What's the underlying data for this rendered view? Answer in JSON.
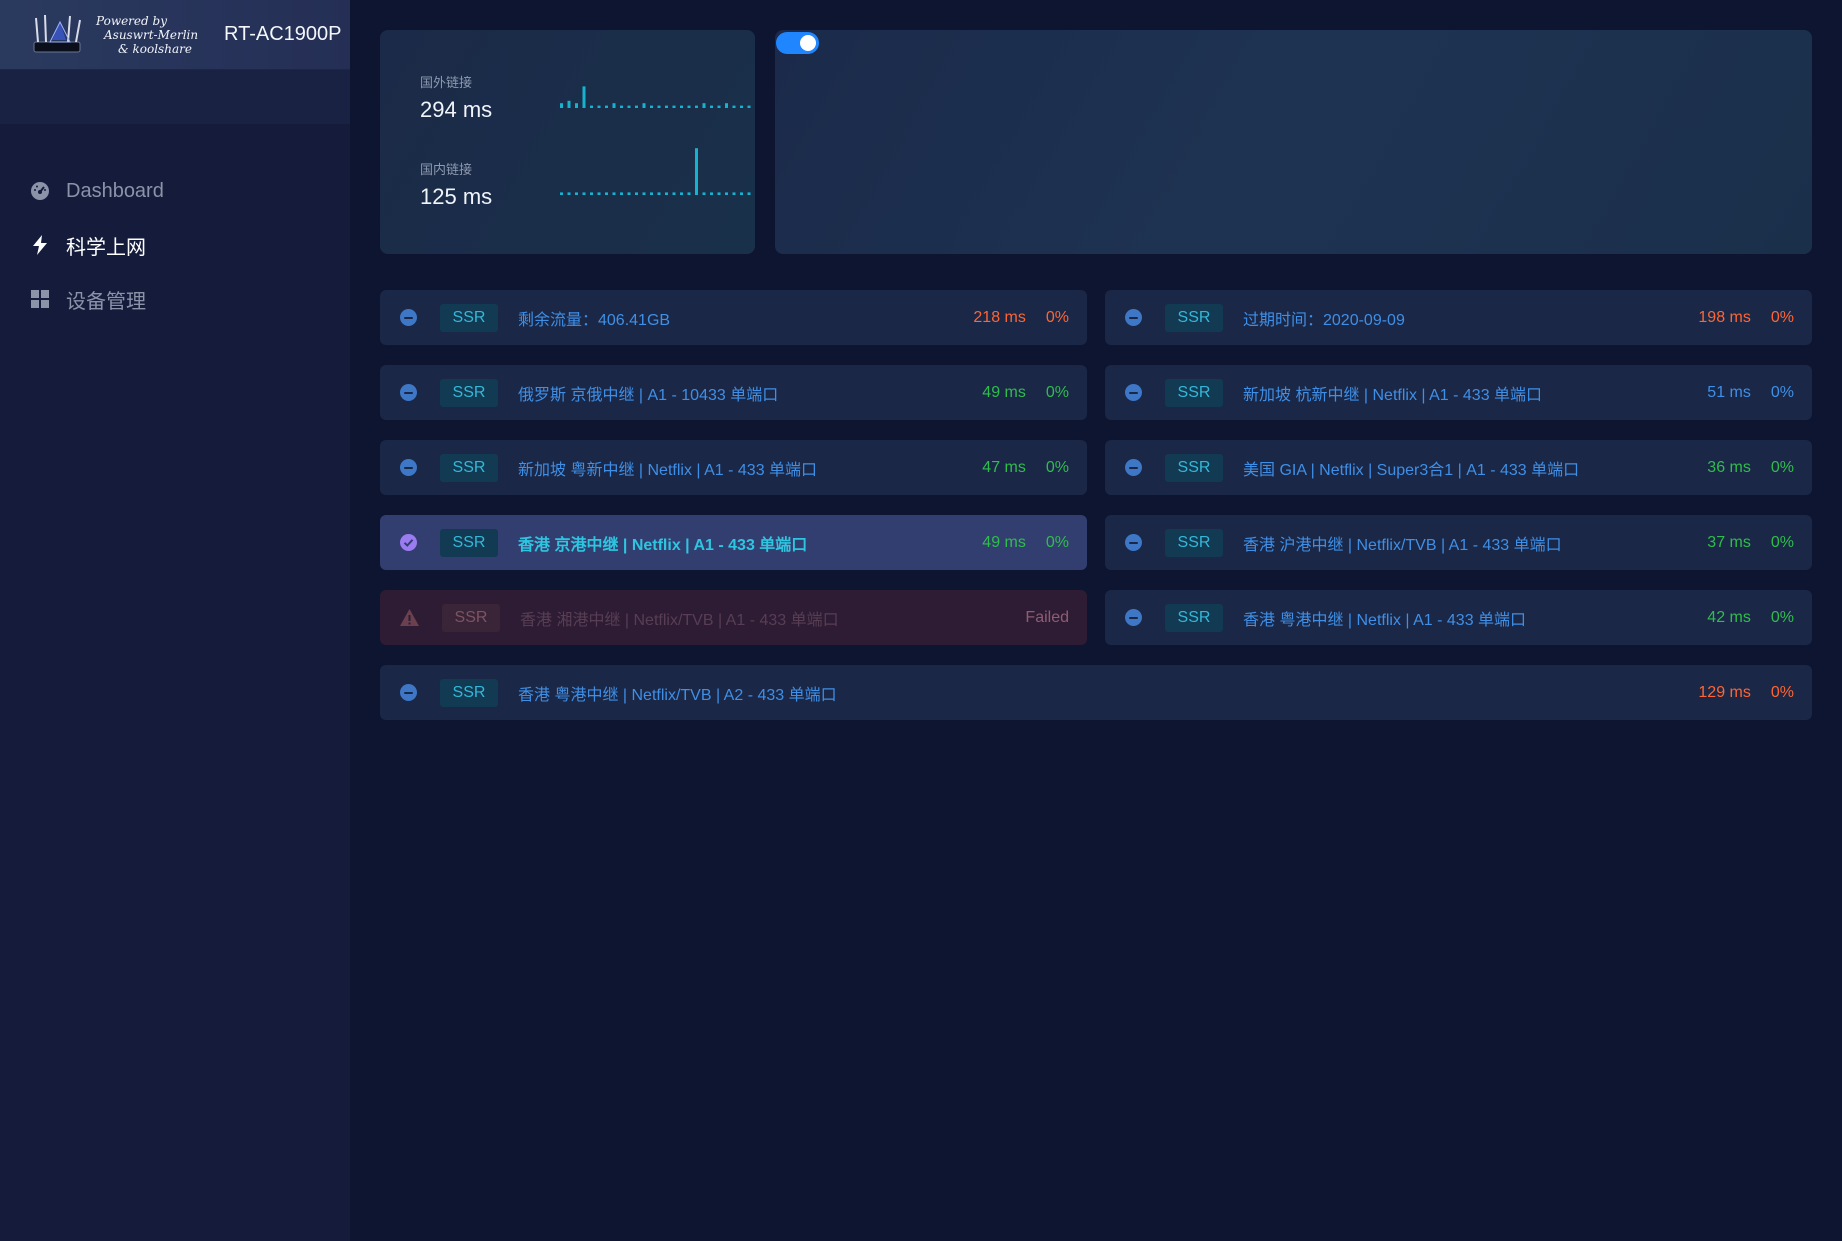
{
  "brand": {
    "powered_line1": "Powered by",
    "powered_line2": "Asuswrt-Merlin",
    "powered_line3": "& koolshare",
    "router_name": "RT-AC1900P"
  },
  "nav": [
    {
      "label": "Dashboard",
      "icon": "dashboard-icon",
      "active": false
    },
    {
      "label": "科学上网",
      "icon": "bolt-icon",
      "active": true
    },
    {
      "label": "设备管理",
      "icon": "grid-icon",
      "active": false
    }
  ],
  "latency": {
    "foreign_label": "国外链接",
    "foreign_value": "294 ms",
    "foreign_samples": [
      2,
      3,
      2,
      9,
      1,
      1,
      1,
      2,
      1,
      1,
      1,
      2,
      1,
      1,
      1,
      1,
      1,
      1,
      1,
      2,
      1,
      1,
      2,
      1,
      1,
      1
    ],
    "domestic_label": "国内链接",
    "domestic_value": "125 ms",
    "domestic_samples": [
      1,
      1,
      1,
      1,
      1,
      1,
      1,
      1,
      1,
      1,
      1,
      1,
      1,
      1,
      1,
      1,
      1,
      1,
      18,
      1,
      1,
      1,
      1,
      1,
      1,
      1
    ]
  },
  "proxy_toggle": {
    "on": true
  },
  "colors": {
    "accent": "#1f86ff",
    "good": "#2fbd4b",
    "warn": "#ff6532",
    "link": "#3f8fe6",
    "selected_text": "#2ec5e0"
  },
  "servers": [
    {
      "protocol": "SSR",
      "name": "剩余流量：406.41GB",
      "ping": "218 ms",
      "ping_color": "orange",
      "loss": "0%",
      "loss_color": "orange",
      "state": "idle"
    },
    {
      "protocol": "SSR",
      "name": "过期时间：2020-09-09",
      "ping": "198 ms",
      "ping_color": "orange",
      "loss": "0%",
      "loss_color": "orange",
      "state": "idle"
    },
    {
      "protocol": "SSR",
      "name": "俄罗斯 京俄中继 | A1 - 10433 单端口",
      "ping": "49 ms",
      "ping_color": "green",
      "loss": "0%",
      "loss_color": "green",
      "state": "idle"
    },
    {
      "protocol": "SSR",
      "name": "新加坡 杭新中继 | Netflix | A1 - 433 单端口",
      "ping": "51 ms",
      "ping_color": "blue",
      "loss": "0%",
      "loss_color": "blue",
      "state": "idle"
    },
    {
      "protocol": "SSR",
      "name": "新加坡 粤新中继 | Netflix | A1 - 433 单端口",
      "ping": "47 ms",
      "ping_color": "green",
      "loss": "0%",
      "loss_color": "green",
      "state": "idle"
    },
    {
      "protocol": "SSR",
      "name": "美国 GIA | Netflix | Super3合1 | A1 - 433 单端口",
      "ping": "36 ms",
      "ping_color": "green",
      "loss": "0%",
      "loss_color": "green",
      "state": "idle"
    },
    {
      "protocol": "SSR",
      "name": "香港 京港中继 | Netflix | A1 - 433 单端口",
      "ping": "49 ms",
      "ping_color": "green",
      "loss": "0%",
      "loss_color": "green",
      "state": "selected"
    },
    {
      "protocol": "SSR",
      "name": "香港 沪港中继 | Netflix/TVB | A1 - 433 单端口",
      "ping": "37 ms",
      "ping_color": "green",
      "loss": "0%",
      "loss_color": "green",
      "state": "idle"
    },
    {
      "protocol": "SSR",
      "name": "香港 湘港中继 | Netflix/TVB | A1 - 433 单端口",
      "ping": "Failed",
      "ping_color": "failed",
      "loss": "",
      "loss_color": "failed",
      "state": "failed"
    },
    {
      "protocol": "SSR",
      "name": "香港 粤港中继 | Netflix | A1 - 433 单端口",
      "ping": "42 ms",
      "ping_color": "green",
      "loss": "0%",
      "loss_color": "green",
      "state": "idle"
    },
    {
      "protocol": "SSR",
      "name": "香港 粤港中继 | Netflix/TVB | A2 - 433 单端口",
      "ping": "129 ms",
      "ping_color": "orange",
      "loss": "0%",
      "loss_color": "orange",
      "state": "idle"
    }
  ]
}
